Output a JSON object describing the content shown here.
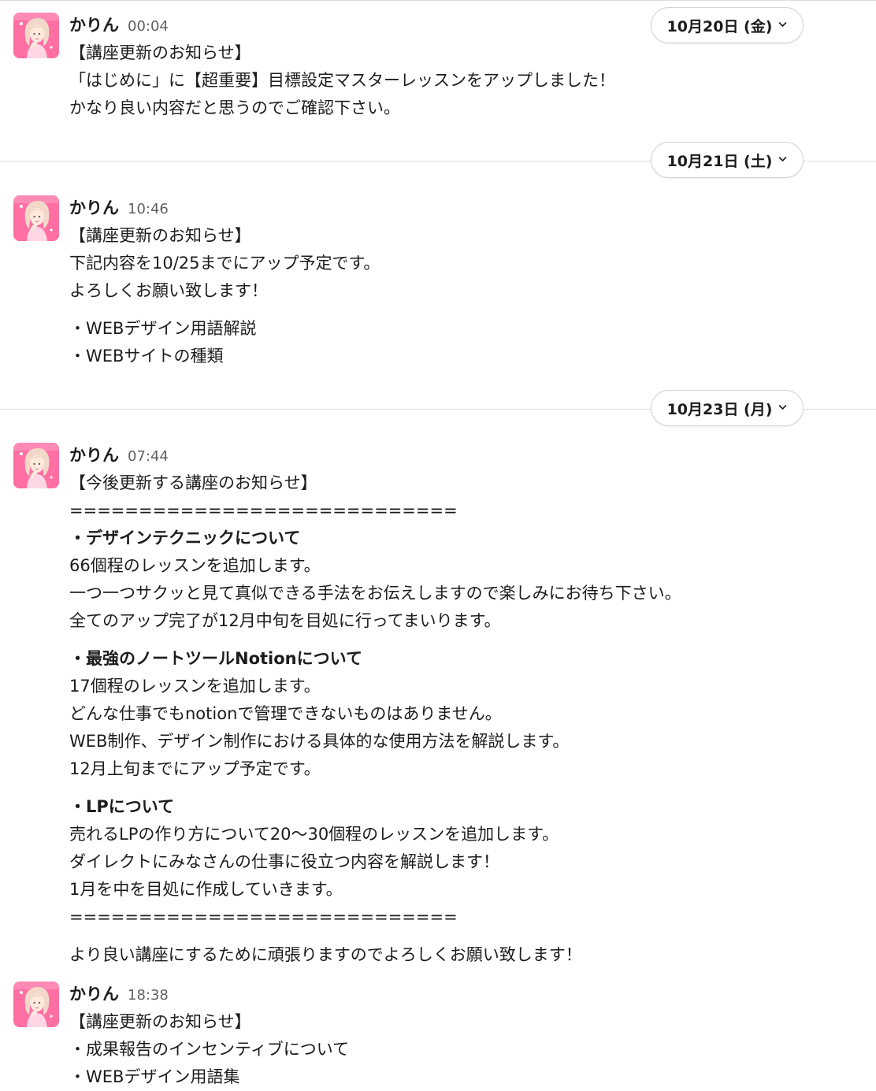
{
  "colors": {
    "background": "#ffffff",
    "text": "#1d1c1d",
    "timestamp": "#616061",
    "divider": "#dddddd",
    "avatar_accent": "#ff5f9a"
  },
  "icons": {
    "avatar": "author-avatar-icon",
    "chevron": "chevron-down-icon"
  },
  "date_dividers": [
    {
      "label": "10月20日 (金)"
    },
    {
      "label": "10月21日 (土)"
    },
    {
      "label": "10月23日 (月)"
    }
  ],
  "messages": [
    {
      "author": "かりん",
      "time": "00:04",
      "lines": [
        "【講座更新のお知らせ】",
        "「はじめに」に【超重要】目標設定マスターレッスンをアップしました！",
        "かなり良い内容だと思うのでご確認下さい。"
      ]
    },
    {
      "author": "かりん",
      "time": "10:46",
      "lines": [
        "【講座更新のお知らせ】",
        "下記内容を10/25までにアップ予定です。",
        "よろしくお願い致します！",
        "・WEBデザイン用語解説",
        "・WEBサイトの種類"
      ]
    },
    {
      "author": "かりん",
      "time": "07:44",
      "lines": [
        "【今後更新する講座のお知らせ】",
        "============================",
        "・デザインテクニックについて",
        "66個程のレッスンを追加します。",
        "一つ一つサクッと見て真似できる手法をお伝えしますので楽しみにお待ち下さい。",
        "全てのアップ完了が12月中旬を目処に行ってまいります。",
        "・最強のノートツールNotionについて",
        "17個程のレッスンを追加します。",
        "どんな仕事でもnotionで管理できないものはありません。",
        "WEB制作、デザイン制作における具体的な使用方法を解説します。",
        "12月上旬までにアップ予定です。",
        "・LPについて",
        "売れるLPの作り方について20〜30個程のレッスンを追加します。",
        "ダイレクトにみなさんの仕事に役立つ内容を解説します！",
        "1月を中を目処に作成していきます。",
        "============================",
        "より良い講座にするために頑張りますのでよろしくお願い致します！"
      ]
    },
    {
      "author": "かりん",
      "time": "18:38",
      "lines": [
        "【講座更新のお知らせ】",
        "・成果報告のインセンティブについて",
        "・WEBデザイン用語集"
      ]
    }
  ]
}
